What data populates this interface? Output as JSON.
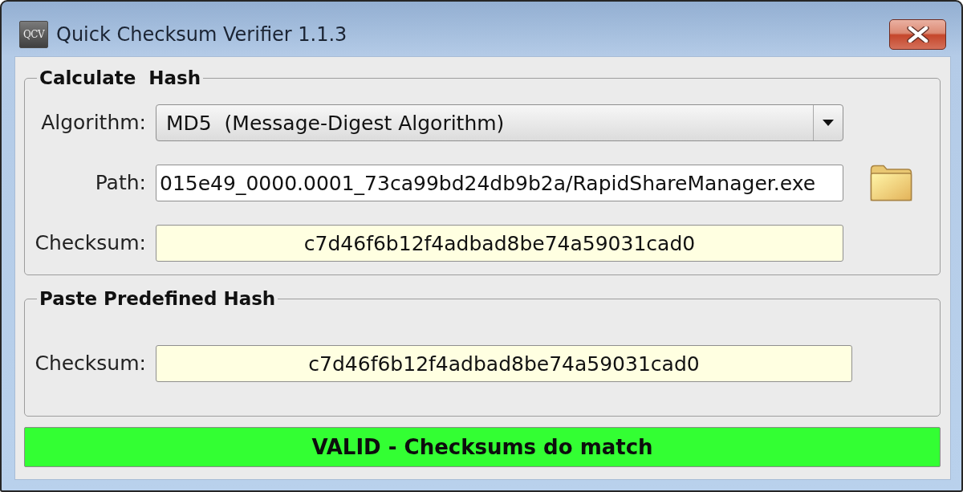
{
  "window": {
    "icon_label": "QCV",
    "title": "Quick Checksum Verifier 1.1.3"
  },
  "calculate_hash": {
    "title": "Calculate  Hash",
    "rows": [
      {
        "kind": "dropdown",
        "label": "Algorithm:",
        "value": "MD5  (Message-Digest Algorithm)"
      },
      {
        "kind": "path",
        "label": "Path:",
        "value": "015e49_0000.0001_73ca99bd24db9b2a/RapidShareManager.exe"
      },
      {
        "kind": "checksum",
        "label": "Checksum:",
        "value": "c7d46f6b12f4adbad8be74a59031cad0"
      }
    ]
  },
  "predefined_hash": {
    "title": "Paste Predefined Hash",
    "rows": [
      {
        "kind": "checksum",
        "label": "Checksum:",
        "value": "c7d46f6b12f4adbad8be74a59031cad0"
      }
    ]
  },
  "result": {
    "valid": true,
    "text": "VALID - Checksums do match"
  }
}
